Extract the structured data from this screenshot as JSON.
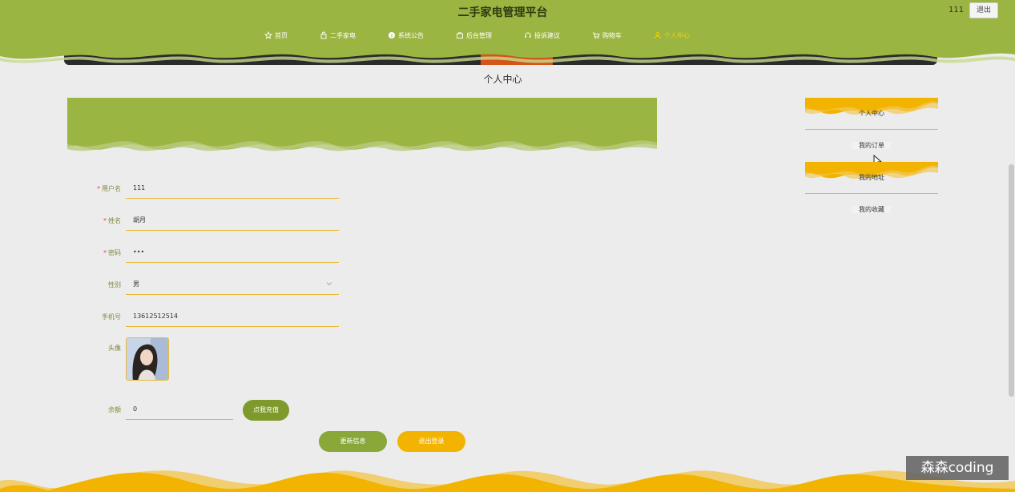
{
  "header": {
    "site_title": "二手家电管理平台",
    "user_name": "111",
    "logout_label": "退出"
  },
  "nav": {
    "items": [
      {
        "label": "首页",
        "icon": "star-icon"
      },
      {
        "label": "二手家电",
        "icon": "bag-icon"
      },
      {
        "label": "系统公告",
        "icon": "info-icon"
      },
      {
        "label": "后台管理",
        "icon": "briefcase-icon"
      },
      {
        "label": "投诉建议",
        "icon": "headset-icon"
      },
      {
        "label": "购物车",
        "icon": "cart-icon"
      },
      {
        "label": "个人中心",
        "icon": "user-icon",
        "active": true
      }
    ]
  },
  "page_title": "个人中心",
  "form": {
    "username": {
      "label": "用户名",
      "required": true,
      "value": "111"
    },
    "name": {
      "label": "姓名",
      "required": true,
      "value": "胡月"
    },
    "password": {
      "label": "密码",
      "required": true,
      "value": "•••"
    },
    "gender": {
      "label": "性别",
      "value": "男"
    },
    "phone": {
      "label": "手机号",
      "value": "13612512514"
    },
    "avatar": {
      "label": "头像"
    },
    "balance": {
      "label": "余额",
      "value": "0"
    },
    "recharge_label": "点我充值",
    "update_label": "更新信息",
    "logout_label": "退出登录"
  },
  "side_menu": {
    "items": [
      {
        "label": "个人中心",
        "active": true
      },
      {
        "label": "我的订单"
      },
      {
        "label": "我的地址",
        "active": true
      },
      {
        "label": "我的收藏"
      }
    ]
  },
  "watermark": "森森coding",
  "colors": {
    "primary_green": "#9bb542",
    "accent_yellow": "#f2b400",
    "button_green": "#7e9a2a",
    "background": "#ececec"
  }
}
